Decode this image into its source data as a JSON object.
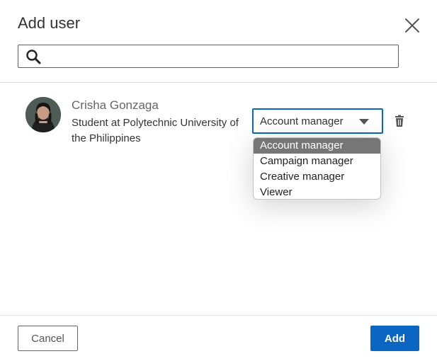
{
  "dialog": {
    "title": "Add user",
    "close_icon": "close-icon"
  },
  "search": {
    "icon": "search-icon",
    "value": "",
    "placeholder": ""
  },
  "user": {
    "name": "Crisha Gonzaga",
    "headline": "Student at Polytechnic University of the Philippines",
    "avatar": "avatar"
  },
  "role_select": {
    "selected": "Account manager",
    "caret_icon": "caret-down-icon",
    "options": [
      "Account manager",
      "Campaign manager",
      "Creative manager",
      "Viewer"
    ],
    "highlighted_index": 0
  },
  "delete_icon": "trash-icon",
  "footer": {
    "cancel_label": "Cancel",
    "add_label": "Add"
  },
  "colors": {
    "primary": "#0a66c2",
    "highlight": "#767676"
  }
}
